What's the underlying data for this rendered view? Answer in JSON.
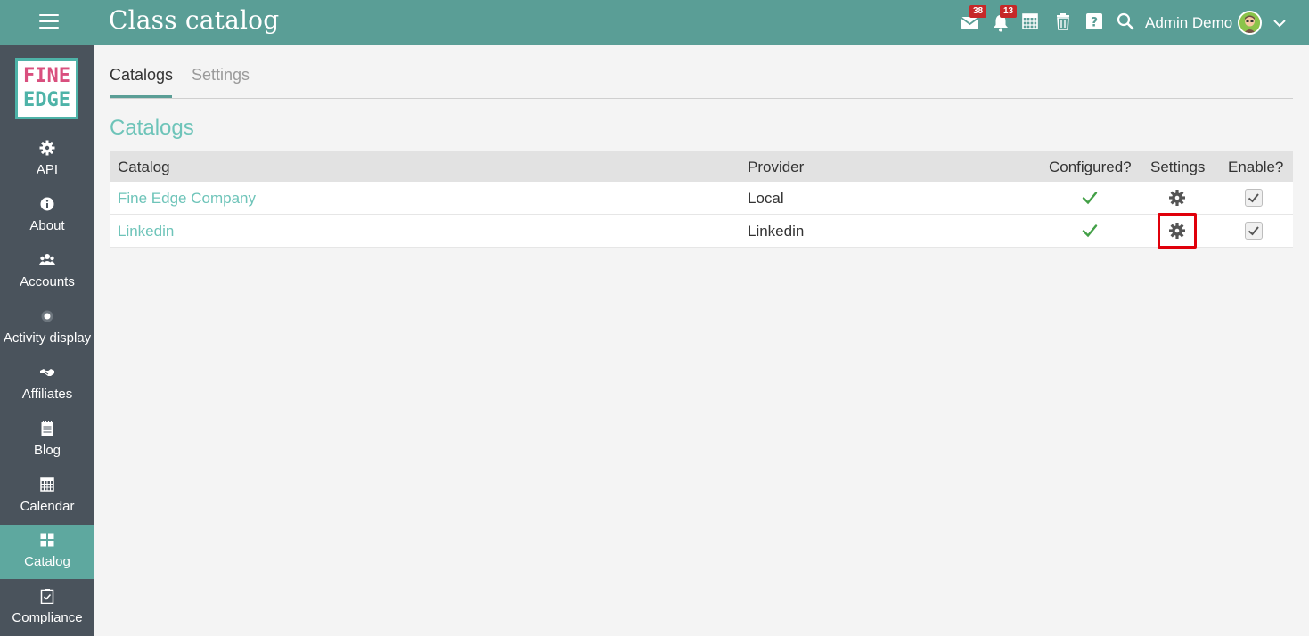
{
  "header": {
    "menu_icon": "hamburger-icon",
    "title": "Class catalog",
    "messages_badge": "38",
    "notifications_badge": "13",
    "user_name": "Admin Demo",
    "colors": {
      "bar": "#5a9e96",
      "badge": "#c62828"
    }
  },
  "sidebar": {
    "logo_line1": "FINE",
    "logo_line2": "EDGE",
    "items": [
      {
        "label": "API",
        "icon": "gear-icon"
      },
      {
        "label": "About",
        "icon": "info-icon"
      },
      {
        "label": "Accounts",
        "icon": "users-icon"
      },
      {
        "label": "Activity display",
        "icon": "dot-circle-icon"
      },
      {
        "label": "Affiliates",
        "icon": "handshake-icon"
      },
      {
        "label": "Blog",
        "icon": "notepad-icon"
      },
      {
        "label": "Calendar",
        "icon": "calendar-icon"
      },
      {
        "label": "Catalog",
        "icon": "grid-icon",
        "active": true
      },
      {
        "label": "Compliance",
        "icon": "clipboard-check-icon"
      }
    ],
    "colors": {
      "bg": "#4a535c",
      "active": "#5ea89f"
    }
  },
  "tabs": [
    {
      "label": "Catalogs",
      "active": true
    },
    {
      "label": "Settings",
      "active": false
    }
  ],
  "section_title": "Catalogs",
  "table": {
    "columns": [
      "Catalog",
      "Provider",
      "Configured?",
      "Settings",
      "Enable?"
    ],
    "rows": [
      {
        "catalog": "Fine Edge Company",
        "provider": "Local",
        "configured": true,
        "enabled": true
      },
      {
        "catalog": "Linkedin",
        "provider": "Linkedin",
        "configured": true,
        "enabled": true
      }
    ]
  },
  "accent_color": "#6ec4b9"
}
